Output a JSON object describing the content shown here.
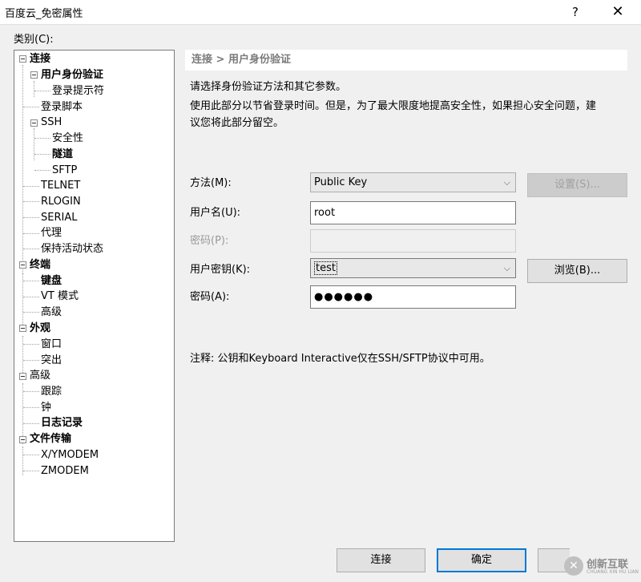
{
  "window": {
    "title": "百度云_免密属性",
    "help_glyph": "?",
    "close_glyph": "✕"
  },
  "category_label": "类别(C):",
  "tree": {
    "items": [
      {
        "label": "连接"
      },
      {
        "label": "用户身份验证"
      },
      {
        "label": "登录提示符"
      },
      {
        "label": "登录脚本"
      },
      {
        "label": "SSH"
      },
      {
        "label": "安全性"
      },
      {
        "label": "隧道"
      },
      {
        "label": "SFTP"
      },
      {
        "label": "TELNET"
      },
      {
        "label": "RLOGIN"
      },
      {
        "label": "SERIAL"
      },
      {
        "label": "代理"
      },
      {
        "label": "保持活动状态"
      },
      {
        "label": "终端"
      },
      {
        "label": "键盘"
      },
      {
        "label": "VT 模式"
      },
      {
        "label": "高级"
      },
      {
        "label": "外观"
      },
      {
        "label": "窗口"
      },
      {
        "label": "突出"
      },
      {
        "label": "高级"
      },
      {
        "label": "跟踪"
      },
      {
        "label": "钟"
      },
      {
        "label": "日志记录"
      },
      {
        "label": "文件传输"
      },
      {
        "label": "X/YMODEM"
      },
      {
        "label": "ZMODEM"
      }
    ]
  },
  "breadcrumb": "连接 > 用户身份验证",
  "description": {
    "line1": "请选择身份验证方法和其它参数。",
    "line2": "使用此部分以节省登录时间。但是，为了最大限度地提高安全性，如果担心安全问题，建",
    "line3": "议您将此部分留空。"
  },
  "form": {
    "method_label": "方法(M):",
    "method_value": "Public Key",
    "settings_button": "设置(S)...",
    "username_label": "用户名(U):",
    "username_value": "root",
    "password_label": "密码(P):",
    "password_value": "",
    "user_key_label": "用户密钥(K):",
    "user_key_value": "test",
    "browse_button": "浏览(B)...",
    "passphrase_label": "密码(A):",
    "passphrase_value": "●●●●●●",
    "dropdown_glyph": "⌵"
  },
  "note": "注释: 公钥和Keyboard Interactive仅在SSH/SFTP协议中可用。",
  "buttons": {
    "connect": "连接",
    "ok": "确定"
  },
  "watermark": {
    "text": "创新互联",
    "sub": "CHUANG XIN HU LIAN",
    "glyph": "✕"
  }
}
